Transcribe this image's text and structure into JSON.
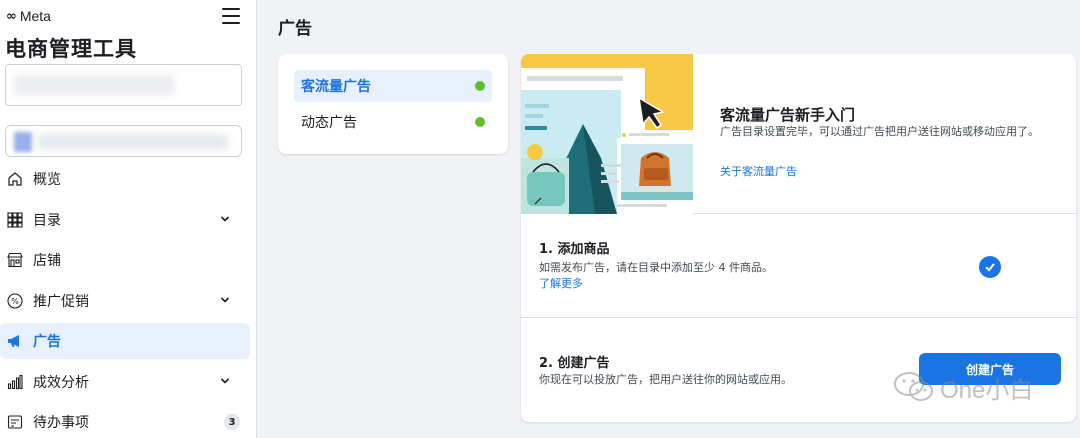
{
  "brand": {
    "logo": "∞",
    "name": "Meta"
  },
  "app_title": "电商管理工具",
  "sidebar": {
    "items": [
      {
        "label": "概览",
        "icon": "home-icon"
      },
      {
        "label": "目录",
        "icon": "grid-icon",
        "expandable": true
      },
      {
        "label": "店铺",
        "icon": "store-icon"
      },
      {
        "label": "推广促销",
        "icon": "percent-icon",
        "expandable": true
      },
      {
        "label": "广告",
        "icon": "megaphone-icon",
        "active": true
      },
      {
        "label": "成效分析",
        "icon": "bar-chart-icon",
        "expandable": true
      },
      {
        "label": "待办事项",
        "icon": "todo-icon",
        "badge": "3"
      }
    ]
  },
  "main": {
    "title": "广告",
    "ad_types": [
      {
        "label": "客流量广告",
        "active": true,
        "status": "active"
      },
      {
        "label": "动态广告",
        "active": false,
        "status": "active"
      }
    ],
    "intro": {
      "title": "客流量广告新手入门",
      "description": "广告目录设置完毕，可以通过广告把用户送往网站或移动应用了。",
      "link": "关于客流量广告"
    },
    "steps": [
      {
        "title": "1. 添加商品",
        "description": "如需发布广告，请在目录中添加至少 4 件商品。",
        "link": "了解更多",
        "completed": true
      },
      {
        "title": "2. 创建广告",
        "description": "你现在可以投放广告，把用户送往你的网站或应用。",
        "button": "创建广告"
      }
    ]
  },
  "watermark": "One小白",
  "colors": {
    "accent": "#1b74e4",
    "status_green": "#5fbf2b",
    "active_bg": "#e7f0fc",
    "page_bg": "#f0f2f5"
  }
}
